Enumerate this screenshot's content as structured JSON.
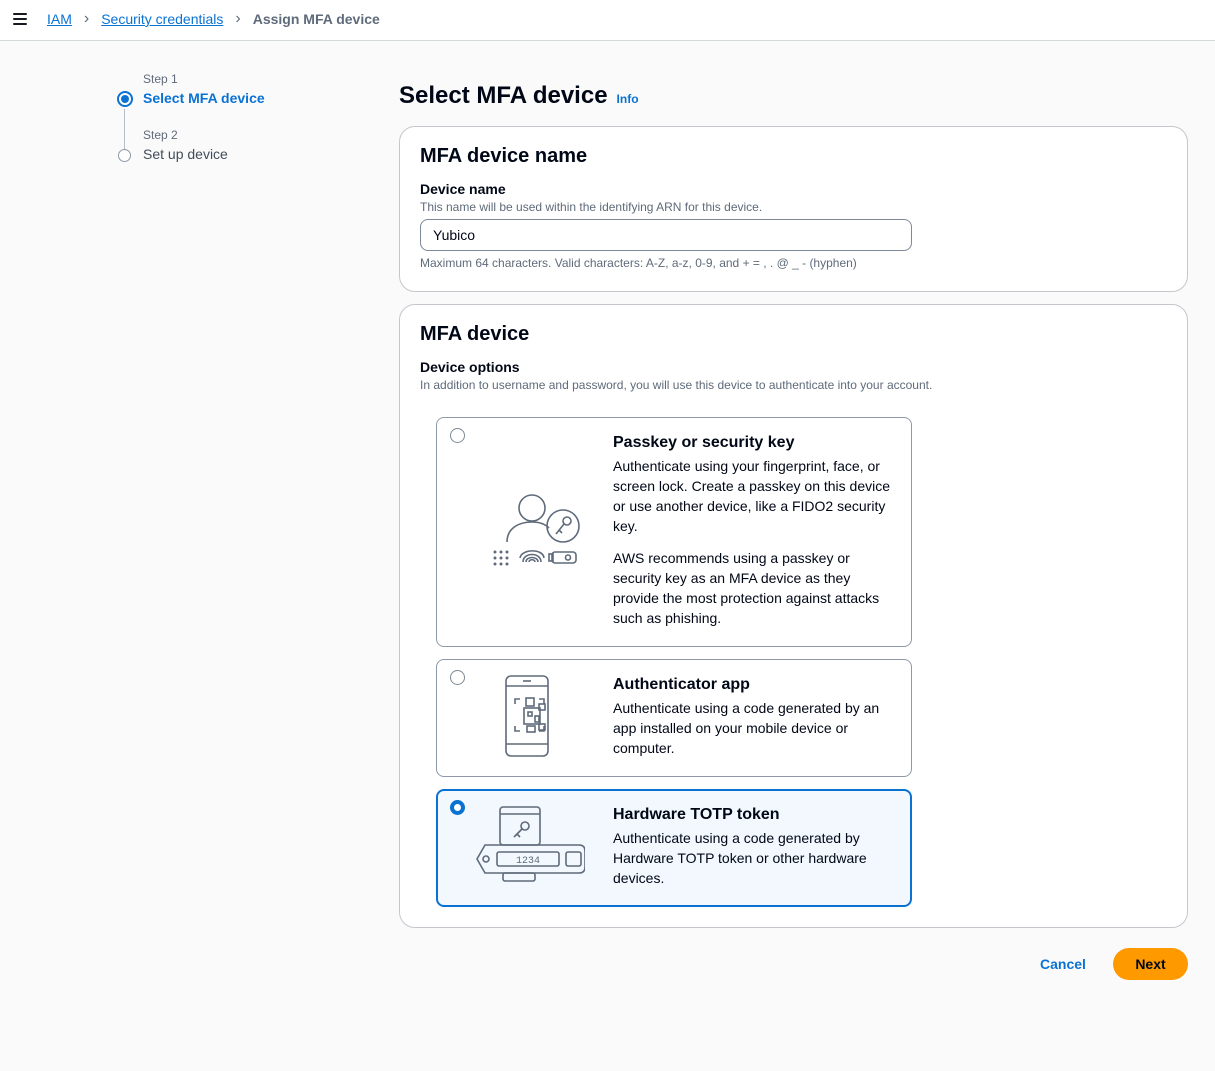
{
  "breadcrumb": {
    "items": [
      "IAM",
      "Security credentials"
    ],
    "current": "Assign MFA device"
  },
  "steps": [
    {
      "label": "Step 1",
      "title": "Select MFA device"
    },
    {
      "label": "Step 2",
      "title": "Set up device"
    }
  ],
  "page": {
    "title": "Select MFA device",
    "info": "Info"
  },
  "name_panel": {
    "title": "MFA device name",
    "field_label": "Device name",
    "field_desc": "This name will be used within the identifying ARN for this device.",
    "value": "Yubico",
    "constraint": "Maximum 64 characters. Valid characters: A-Z, a-z, 0-9, and + = , . @ _ - (hyphen)"
  },
  "device_panel": {
    "title": "MFA device",
    "field_label": "Device options",
    "field_desc": "In addition to username and password, you will use this device to authenticate into your account.",
    "options": [
      {
        "title": "Passkey or security key",
        "desc": "Authenticate using your fingerprint, face, or screen lock. Create a passkey on this device or use another device, like a FIDO2 security key.",
        "desc2": "AWS recommends using a passkey or security key as an MFA device as they provide the most protection against attacks such as phishing.",
        "icon": "passkey-icon",
        "selected": false
      },
      {
        "title": "Authenticator app",
        "desc": "Authenticate using a code generated by an app installed on your mobile device or computer.",
        "icon": "phone-qr-icon",
        "selected": false
      },
      {
        "title": "Hardware TOTP token",
        "desc": "Authenticate using a code generated by Hardware TOTP token or other hardware devices.",
        "icon": "hardware-token-icon",
        "token_display": "1234",
        "selected": true
      }
    ]
  },
  "actions": {
    "cancel": "Cancel",
    "next": "Next"
  },
  "colors": {
    "link": "#0972d3",
    "primary_button": "#ff9900",
    "selected_bg": "#f2f8fd"
  }
}
